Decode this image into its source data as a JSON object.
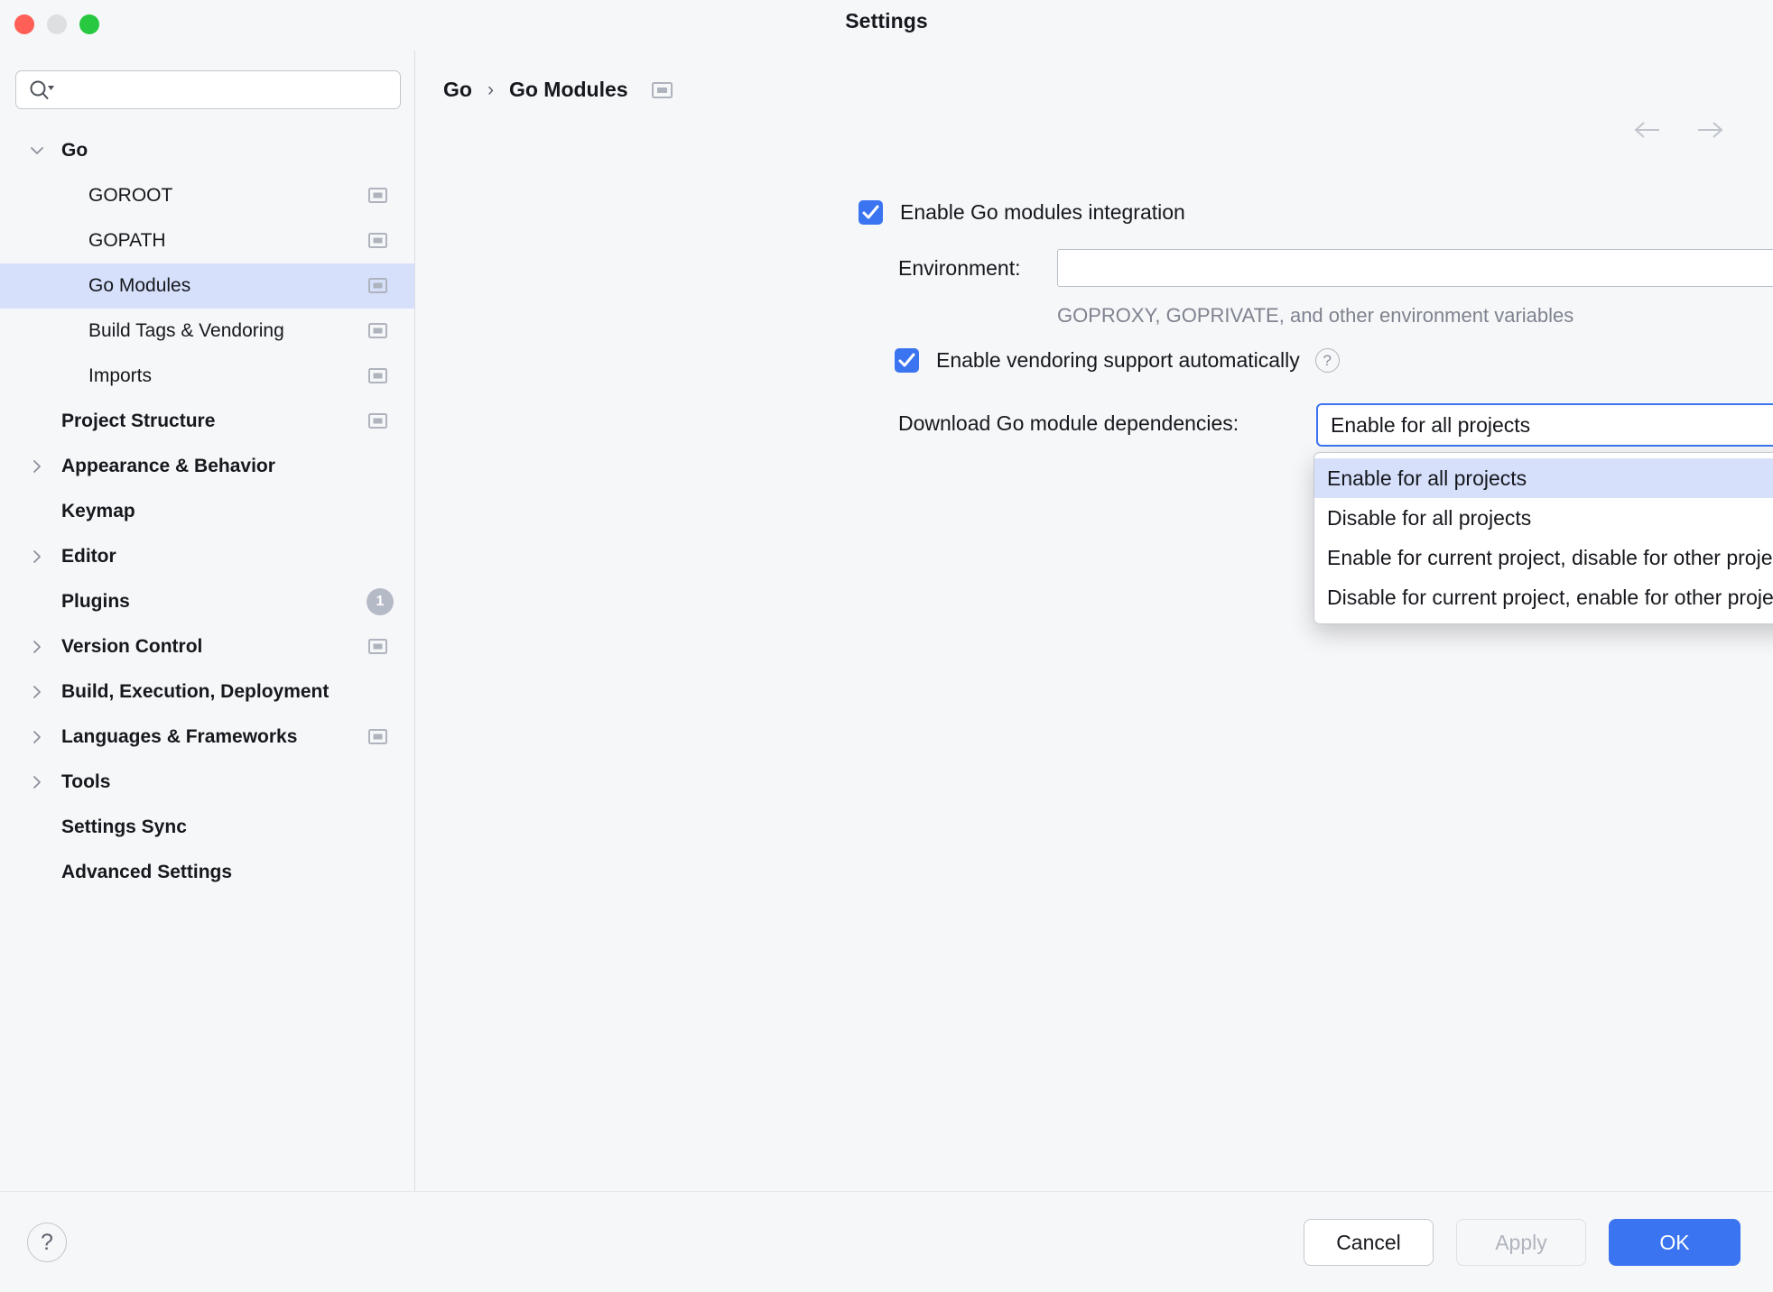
{
  "window": {
    "title": "Settings",
    "traffic_lights": [
      "close-red",
      "minimize-yellow",
      "zoom-green"
    ]
  },
  "sidebar": {
    "search": {
      "value": "",
      "placeholder": ""
    },
    "items": [
      {
        "label": "Go",
        "level": 0,
        "chevron": "down",
        "icon": false,
        "selected": false
      },
      {
        "label": "GOROOT",
        "level": 1,
        "chevron": "none",
        "icon": true,
        "selected": false
      },
      {
        "label": "GOPATH",
        "level": 1,
        "chevron": "none",
        "icon": true,
        "selected": false
      },
      {
        "label": "Go Modules",
        "level": 1,
        "chevron": "none",
        "icon": true,
        "selected": true
      },
      {
        "label": "Build Tags & Vendoring",
        "level": 1,
        "chevron": "none",
        "icon": true,
        "selected": false
      },
      {
        "label": "Imports",
        "level": 1,
        "chevron": "none",
        "icon": true,
        "selected": false
      },
      {
        "label": "Project Structure",
        "level": 0,
        "chevron": "none",
        "icon": true,
        "selected": false
      },
      {
        "label": "Appearance & Behavior",
        "level": 0,
        "chevron": "right",
        "icon": false,
        "selected": false
      },
      {
        "label": "Keymap",
        "level": 0,
        "chevron": "none",
        "icon": false,
        "selected": false
      },
      {
        "label": "Editor",
        "level": 0,
        "chevron": "right",
        "icon": false,
        "selected": false
      },
      {
        "label": "Plugins",
        "level": 0,
        "chevron": "none",
        "icon": false,
        "selected": false,
        "badge": "1"
      },
      {
        "label": "Version Control",
        "level": 0,
        "chevron": "right",
        "icon": true,
        "selected": false
      },
      {
        "label": "Build, Execution, Deployment",
        "level": 0,
        "chevron": "right",
        "icon": false,
        "selected": false
      },
      {
        "label": "Languages & Frameworks",
        "level": 0,
        "chevron": "right",
        "icon": true,
        "selected": false
      },
      {
        "label": "Tools",
        "level": 0,
        "chevron": "right",
        "icon": false,
        "selected": false
      },
      {
        "label": "Settings Sync",
        "level": 0,
        "chevron": "none",
        "icon": false,
        "selected": false
      },
      {
        "label": "Advanced Settings",
        "level": 0,
        "chevron": "none",
        "icon": false,
        "selected": false
      }
    ]
  },
  "main": {
    "breadcrumb": {
      "root": "Go",
      "separator": "›",
      "current": "Go Modules"
    },
    "enable_modules": {
      "label": "Enable Go modules integration",
      "checked": true
    },
    "environment": {
      "label": "Environment:",
      "value": "",
      "placeholder": "",
      "hint": "GOPROXY, GOPRIVATE, and other environment variables"
    },
    "vendoring": {
      "label": "Enable vendoring support automatically",
      "checked": true,
      "help": "?"
    },
    "download": {
      "label": "Download Go module dependencies:",
      "selected": "Enable for all projects",
      "help": "?",
      "options": [
        "Enable for all projects",
        "Disable for all projects",
        "Enable for current project, disable for other projects",
        "Disable for current project, enable for other projects"
      ],
      "active_index": 0
    }
  },
  "footer": {
    "help": "?",
    "cancel": "Cancel",
    "apply": "Apply",
    "ok": "OK"
  },
  "colors": {
    "accent": "#3b74f1",
    "selection": "#d6e0fb",
    "background": "#f6f7f9",
    "text": "#16181d",
    "muted": "#7e838f"
  }
}
